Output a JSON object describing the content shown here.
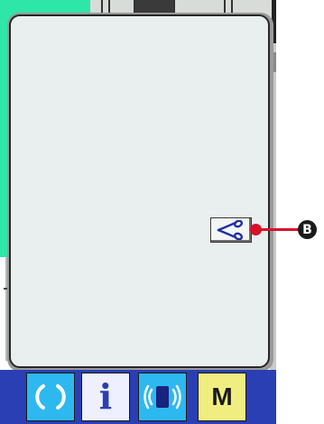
{
  "dialog": {
    "trim_button_icon": "scissors-icon"
  },
  "callout": {
    "label": "B",
    "color": "#d8102a"
  },
  "navbar": {
    "ready_icon": "ready-cycle-icon",
    "info_label": "i",
    "communication_icon": "communication-icon",
    "mode_label": "M"
  },
  "colors": {
    "background_green": "#2ee6a8",
    "navbar_blue": "#2a3fb4",
    "button_cyan": "#2eb8f0",
    "mode_yellow": "#f0ee80"
  }
}
